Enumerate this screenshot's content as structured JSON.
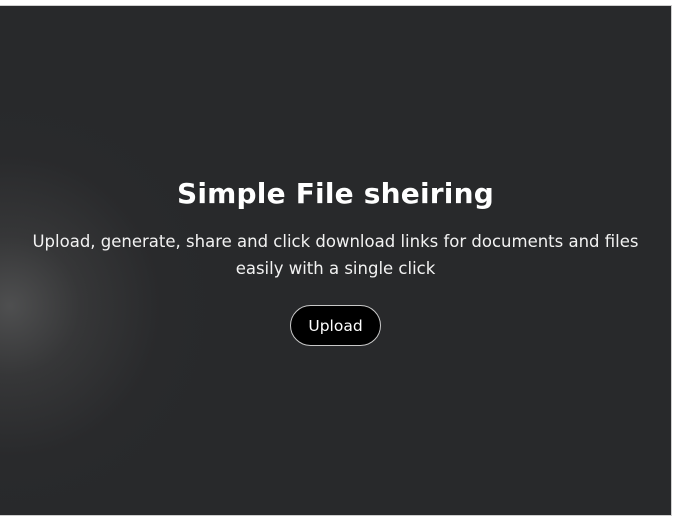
{
  "hero": {
    "title": "Simple File sheiring",
    "subtitle": "Upload, generate, share and click download links for documents and files easily with a single click",
    "upload_label": "Upload"
  },
  "colors": {
    "background": "#28292b",
    "button": "#000000",
    "text": "#ffffff"
  }
}
